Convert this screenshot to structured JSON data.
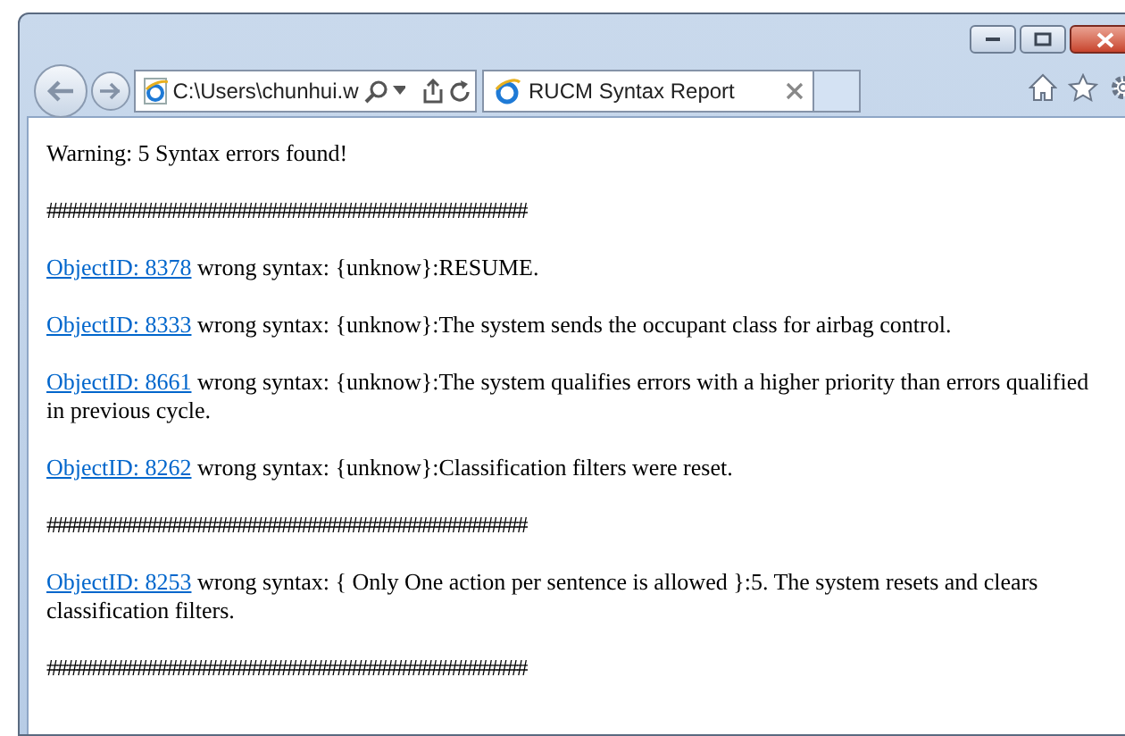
{
  "address_bar": {
    "value": "C:\\Users\\chunhui.w"
  },
  "tabs": [
    {
      "label": "RUCM Syntax Report",
      "selected": true
    }
  ],
  "content": [
    {
      "kind": "text",
      "text": "Warning: 5 Syntax errors found!"
    },
    {
      "kind": "separator",
      "text": "################################################"
    },
    {
      "kind": "error",
      "link": "ObjectID: 8378",
      "text": "wrong syntax: {unknow}:RESUME."
    },
    {
      "kind": "error",
      "link": "ObjectID: 8333",
      "text": "wrong syntax: {unknow}:The system sends the occupant class for airbag control."
    },
    {
      "kind": "error",
      "link": "ObjectID: 8661",
      "text": "wrong syntax: {unknow}:The system qualifies errors with a higher priority than errors qualified in previous cycle."
    },
    {
      "kind": "error",
      "link": "ObjectID: 8262",
      "text": "wrong syntax: {unknow}:Classification filters were reset."
    },
    {
      "kind": "separator",
      "text": "################################################"
    },
    {
      "kind": "error",
      "link": "ObjectID: 8253",
      "text": "wrong syntax: { Only One action per sentence is allowed }:5. The system resets and clears classification filters."
    },
    {
      "kind": "separator",
      "text": "################################################"
    }
  ]
}
